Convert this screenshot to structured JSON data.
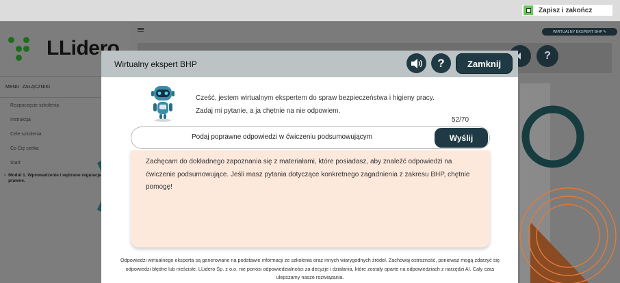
{
  "topbar": {
    "save_label": "Zapisz i zakończ"
  },
  "sidebar": {
    "logo_text": "LLidero",
    "tabs": [
      "MENU",
      "ZAŁĄCZNIKI"
    ],
    "items": [
      "Rozpoczęcie szkolenia",
      "Instrukcja",
      "Cele szkolenia",
      "Co Cię czeka",
      "Start"
    ],
    "module_arrow": "›",
    "module_label": "Moduł 1. Wprowadzenie i wybrane regulacje prawne."
  },
  "background": {
    "expert_pill": "WIRTUALNY EKSPERT BHP ✎",
    "help_glyph": "?"
  },
  "modal": {
    "title": "Wirtualny ekspert BHP",
    "speaker_icon": "speaker-icon",
    "help_glyph": "?",
    "close_label": "Zamknij",
    "intro_line1": "Cześć, jestem wirtualnym ekspertem do spraw bezpieczeństwa i higieny pracy.",
    "intro_line2": "Zadaj mi pytanie, a ja chętnie na nie odpowiem.",
    "counter": "52/70",
    "question_value": "Podaj poprawne odpowiedzi w ćwiczeniu podsumowującym",
    "send_label": "Wyślij",
    "answer_text": "Zachęcam do dokładnego zapoznania się z materiałami, które posiadasz, aby znaleźć odpowiedzi na ćwiczenie podsumowujące. Jeśli masz pytania dotyczące konkretnego zagadnienia z zakresu BHP, chętnie pomogę!",
    "disclaimer": "Odpowiedzi wirtualnego eksperta są generowane na podstawie informacji ze szkolenia oraz innych wiarygodnych źródeł. Zachowaj ostrożność, ponieważ mogą zdarzyć się odpowiedzi błędne lub nieścisłe. LLidero Sp. z o.o. nie ponosi odpowiedzialności za decyzje i działania, które zostały oparte na odpowiedziach z narzędzi AI. Cały czas ulepszamy nasze rozwiązania."
  },
  "colors": {
    "accent_dark": "#1f3a44",
    "answer_bg": "#fde8dc",
    "logo_green": "#1c6e1c",
    "save_green": "#6ac85a",
    "deco_orange": "#e07a3a",
    "deco_teal": "#1e5458"
  }
}
